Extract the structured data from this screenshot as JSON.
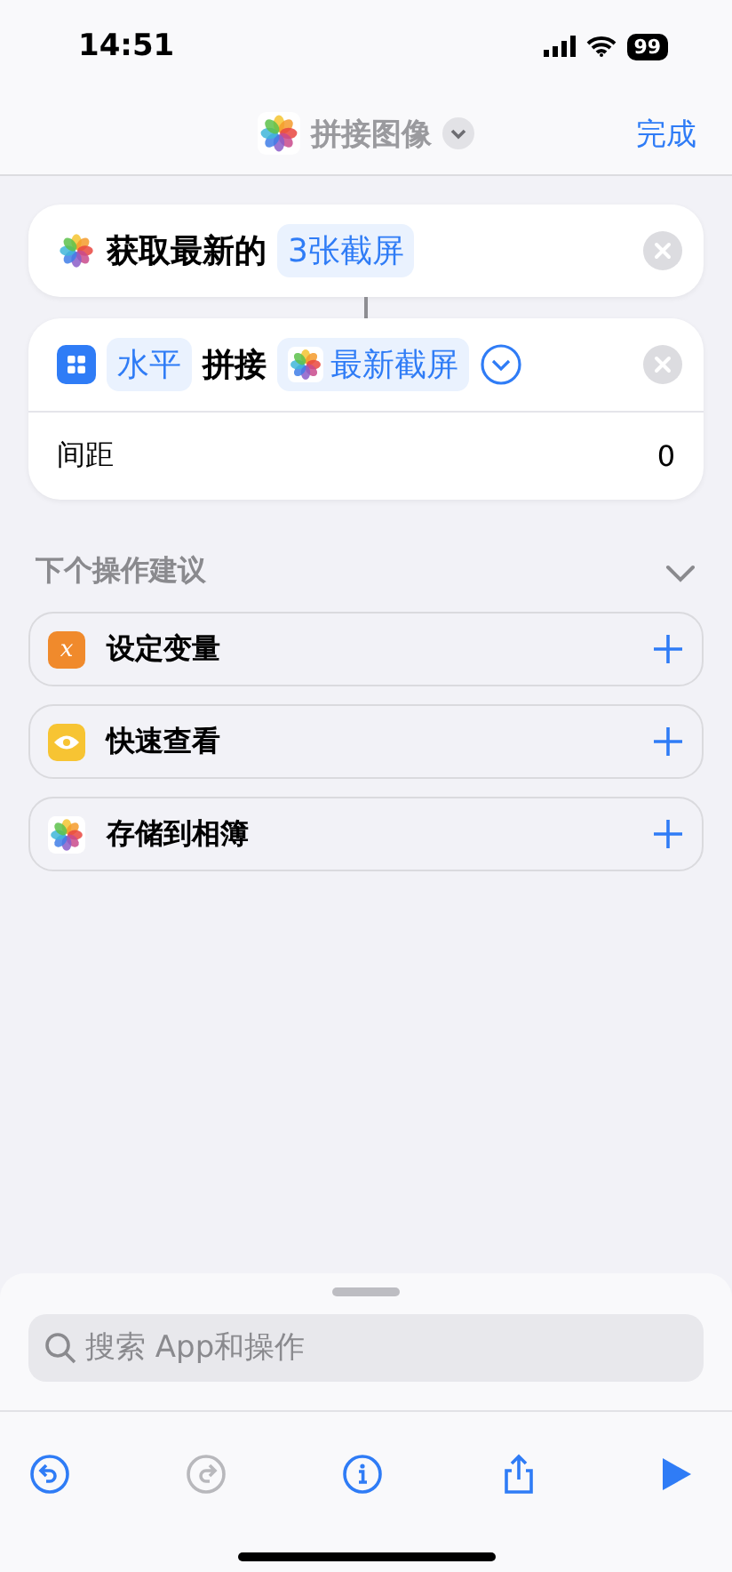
{
  "status_bar": {
    "time": "14:51",
    "battery": "99"
  },
  "header": {
    "title": "拼接图像",
    "done": "完成"
  },
  "actions": [
    {
      "kind": "photos",
      "parts": [
        {
          "text": "获取最新的",
          "token": false
        },
        {
          "text": "3张截屏",
          "token": true
        }
      ]
    },
    {
      "kind": "layout",
      "parts": [
        {
          "text": "水平",
          "token": true
        },
        {
          "text": "拼接",
          "token": false
        },
        {
          "text": "最新截屏",
          "token": true,
          "photos": true
        }
      ],
      "expanded": true,
      "options": [
        {
          "label": "间距",
          "value": "0"
        }
      ]
    }
  ],
  "suggestions": {
    "title": "下个操作建议",
    "expanded": true,
    "items": [
      {
        "kind": "variable",
        "glyph": "x",
        "label": "设定变量"
      },
      {
        "kind": "eye",
        "label": "快速查看"
      },
      {
        "kind": "photos",
        "label": "存储到相簿"
      }
    ]
  },
  "search": {
    "placeholder": "搜索 App和操作"
  },
  "toolbar": [
    {
      "kind": "undo",
      "disabled": false
    },
    {
      "kind": "redo",
      "disabled": true
    },
    {
      "kind": "info",
      "disabled": false
    },
    {
      "kind": "share",
      "disabled": false
    },
    {
      "kind": "run",
      "disabled": false
    }
  ]
}
